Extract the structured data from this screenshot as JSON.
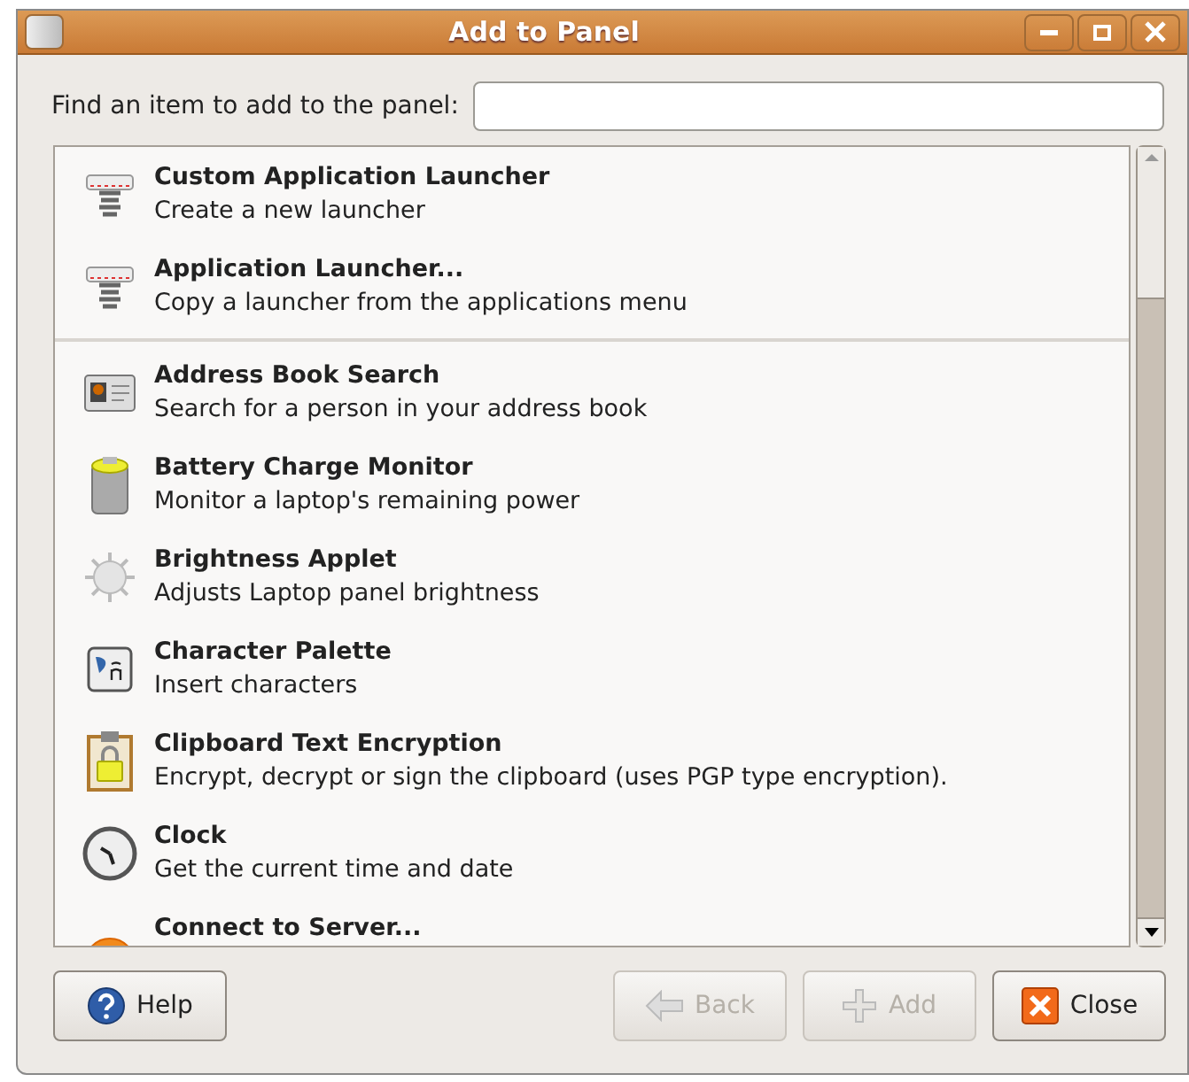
{
  "window": {
    "title": "Add to Panel"
  },
  "search": {
    "label": "Find an item to add to the panel:"
  },
  "groups": [
    [
      {
        "kind": "launcher",
        "name": "Custom Application Launcher",
        "description": "Create a new launcher"
      },
      {
        "kind": "launcher",
        "name": "Application Launcher...",
        "description": "Copy a launcher from the applications menu"
      }
    ],
    [
      {
        "kind": "card",
        "name": "Address Book Search",
        "description": "Search for a person in your address book"
      },
      {
        "kind": "battery",
        "name": "Battery Charge Monitor",
        "description": "Monitor a laptop's remaining power"
      },
      {
        "kind": "sun",
        "name": "Brightness Applet",
        "description": "Adjusts Laptop panel brightness"
      },
      {
        "kind": "chars",
        "name": "Character Palette",
        "description": "Insert characters"
      },
      {
        "kind": "lock",
        "name": "Clipboard Text Encryption",
        "description": "Encrypt, decrypt or sign the clipboard (uses PGP type encryption)."
      },
      {
        "kind": "clock",
        "name": "Clock",
        "description": "Get the current time and date"
      },
      {
        "kind": "globe",
        "name": "Connect to Server..."
      }
    ]
  ],
  "buttons": [
    {
      "kind": "help",
      "label": "Help",
      "disabled": false
    },
    {
      "kind": "back",
      "label": "Back",
      "disabled": true
    },
    {
      "kind": "add",
      "label": "Add",
      "disabled": true
    },
    {
      "kind": "close",
      "label": "Close",
      "disabled": false
    }
  ]
}
